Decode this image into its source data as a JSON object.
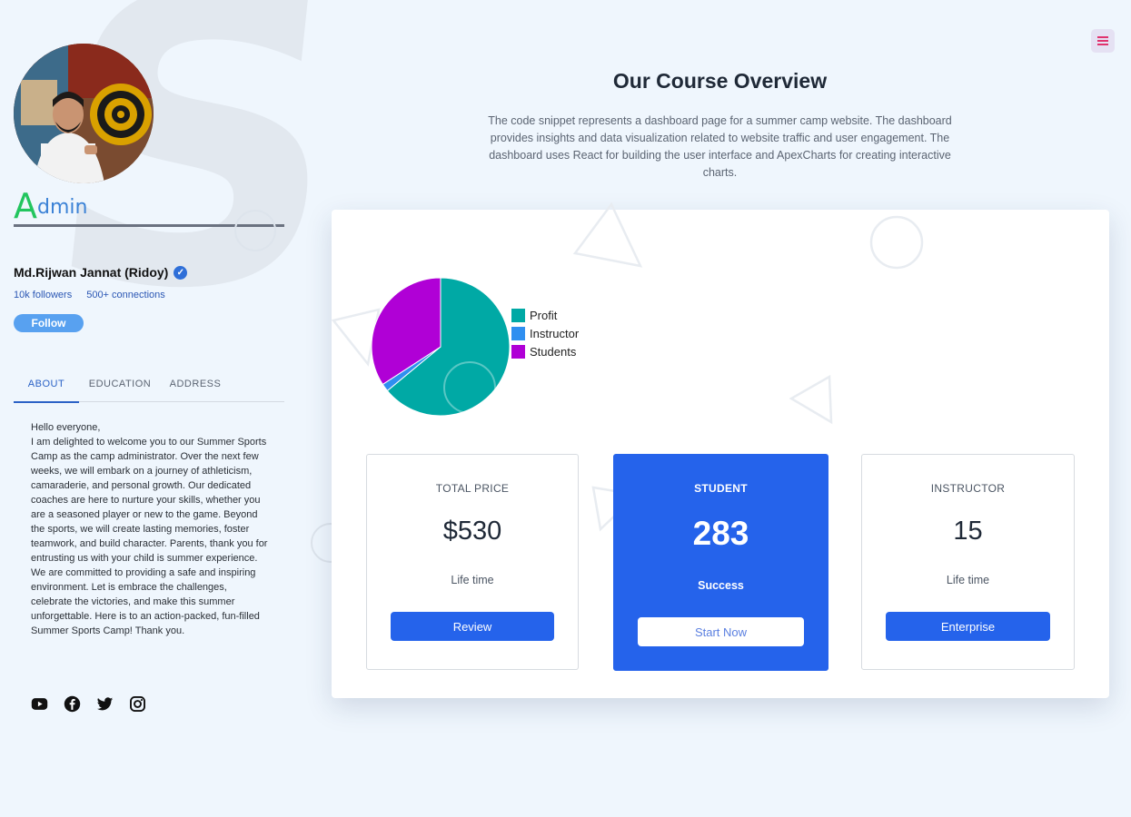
{
  "sidebar": {
    "brand_initial": "A",
    "brand_rest": "dmin",
    "user_name": "Md.Rijwan Jannat (Ridoy)",
    "followers": "10k followers",
    "connections": "500+ connections",
    "follow_label": "Follow",
    "tabs": [
      {
        "label": "ABOUT",
        "active": true
      },
      {
        "label": "EDUCATION",
        "active": false
      },
      {
        "label": "ADDRESS",
        "active": false
      }
    ],
    "about_text": "Hello everyone,\nI am delighted to welcome you to our Summer Sports Camp as the camp administrator. Over the next few weeks, we will embark on a journey of athleticism, camaraderie, and personal growth. Our dedicated coaches are here to nurture your skills, whether you are a seasoned player or new to the game. Beyond the sports, we will create lasting memories, foster teamwork, and build character. Parents, thank you for entrusting us with your child is summer experience. We are committed to providing a safe and inspiring environment. Let is embrace the challenges, celebrate the victories, and make this summer unforgettable. Here is to an action-packed, fun-filled Summer Sports Camp! Thank you.",
    "socials": [
      "youtube-icon",
      "facebook-icon",
      "twitter-icon",
      "instagram-icon"
    ]
  },
  "header": {
    "title": "Our Course Overview",
    "description": "The code snippet represents a dashboard page for a summer camp website. The dashboard provides insights and data visualization related to website traffic and user engagement. The dashboard uses React for building the user interface and ApexCharts for creating interactive charts."
  },
  "chart_data": {
    "type": "pie",
    "labels": [
      "Profit",
      "Instructor",
      "Students"
    ],
    "values": [
      530,
      15,
      283
    ],
    "colors": [
      "#00a9a5",
      "#2f8ff0",
      "#b000d6"
    ]
  },
  "stats": [
    {
      "label": "TOTAL PRICE",
      "value": "$530",
      "sub": "Life time",
      "button": "Review"
    },
    {
      "label": "STUDENT",
      "value": "283",
      "sub": "Success",
      "button": "Start Now"
    },
    {
      "label": "INSTRUCTOR",
      "value": "15",
      "sub": "Life time",
      "button": "Enterprise"
    }
  ],
  "colors": {
    "accent": "#2563eb",
    "brand_initial": "#22c55e",
    "brand_text": "#3b82d6"
  }
}
